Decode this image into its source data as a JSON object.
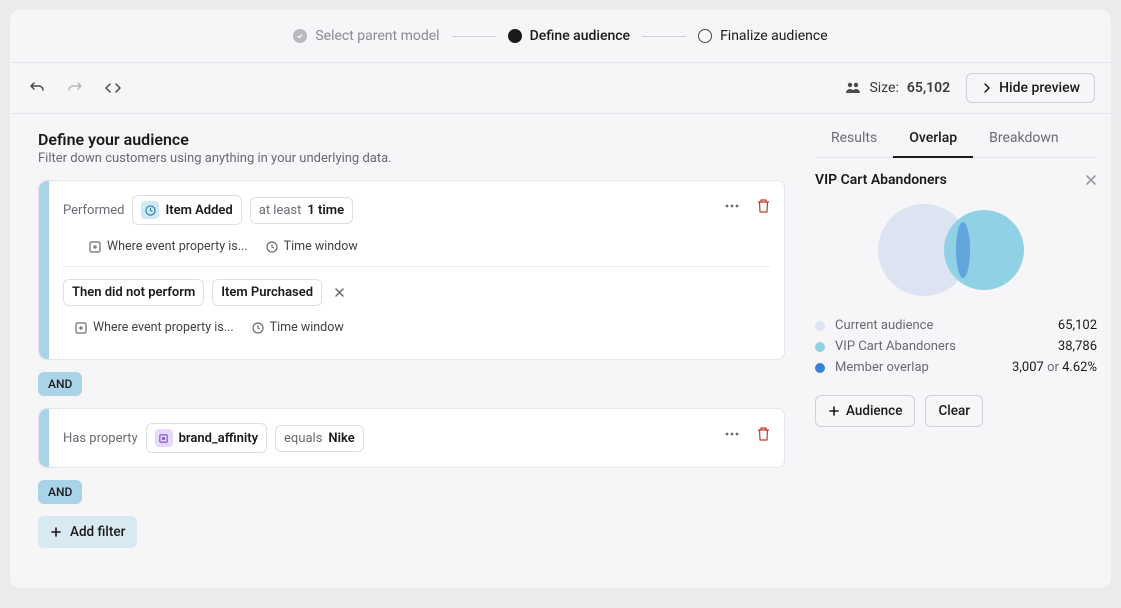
{
  "stepper": {
    "step1": "Select parent model",
    "step2": "Define audience",
    "step3": "Finalize audience"
  },
  "toolbar": {
    "size_label": "Size:",
    "size_value": "65,102",
    "hide_preview": "Hide preview"
  },
  "header": {
    "title": "Define your audience",
    "subtitle": "Filter down customers using anything in your underlying data."
  },
  "filters": {
    "block1": {
      "performed_label": "Performed",
      "event1": "Item Added",
      "frequency_prefix": "at least",
      "frequency_value": "1 time",
      "where_event_prop": "Where event property is...",
      "time_window": "Time window",
      "then_label": "Then did not perform",
      "event2": "Item Purchased"
    },
    "block2": {
      "has_property": "Has property",
      "prop_name": "brand_affinity",
      "operator": "equals",
      "value": "Nike"
    },
    "and_label": "AND",
    "add_filter": "Add filter"
  },
  "panel": {
    "tabs": {
      "results": "Results",
      "overlap": "Overlap",
      "breakdown": "Breakdown"
    },
    "title": "VIP Cart Abandoners",
    "legend": {
      "current_name": "Current audience",
      "current_value": "65,102",
      "compare_name": "VIP Cart Abandoners",
      "compare_value": "38,786",
      "overlap_name": "Member overlap",
      "overlap_value": "3,007",
      "or": "or",
      "overlap_pct": "4.62%"
    },
    "buttons": {
      "audience": "Audience",
      "clear": "Clear"
    },
    "colors": {
      "current": "#dde3f0",
      "compare": "#91d1e6",
      "overlap": "#3b82d4"
    }
  }
}
